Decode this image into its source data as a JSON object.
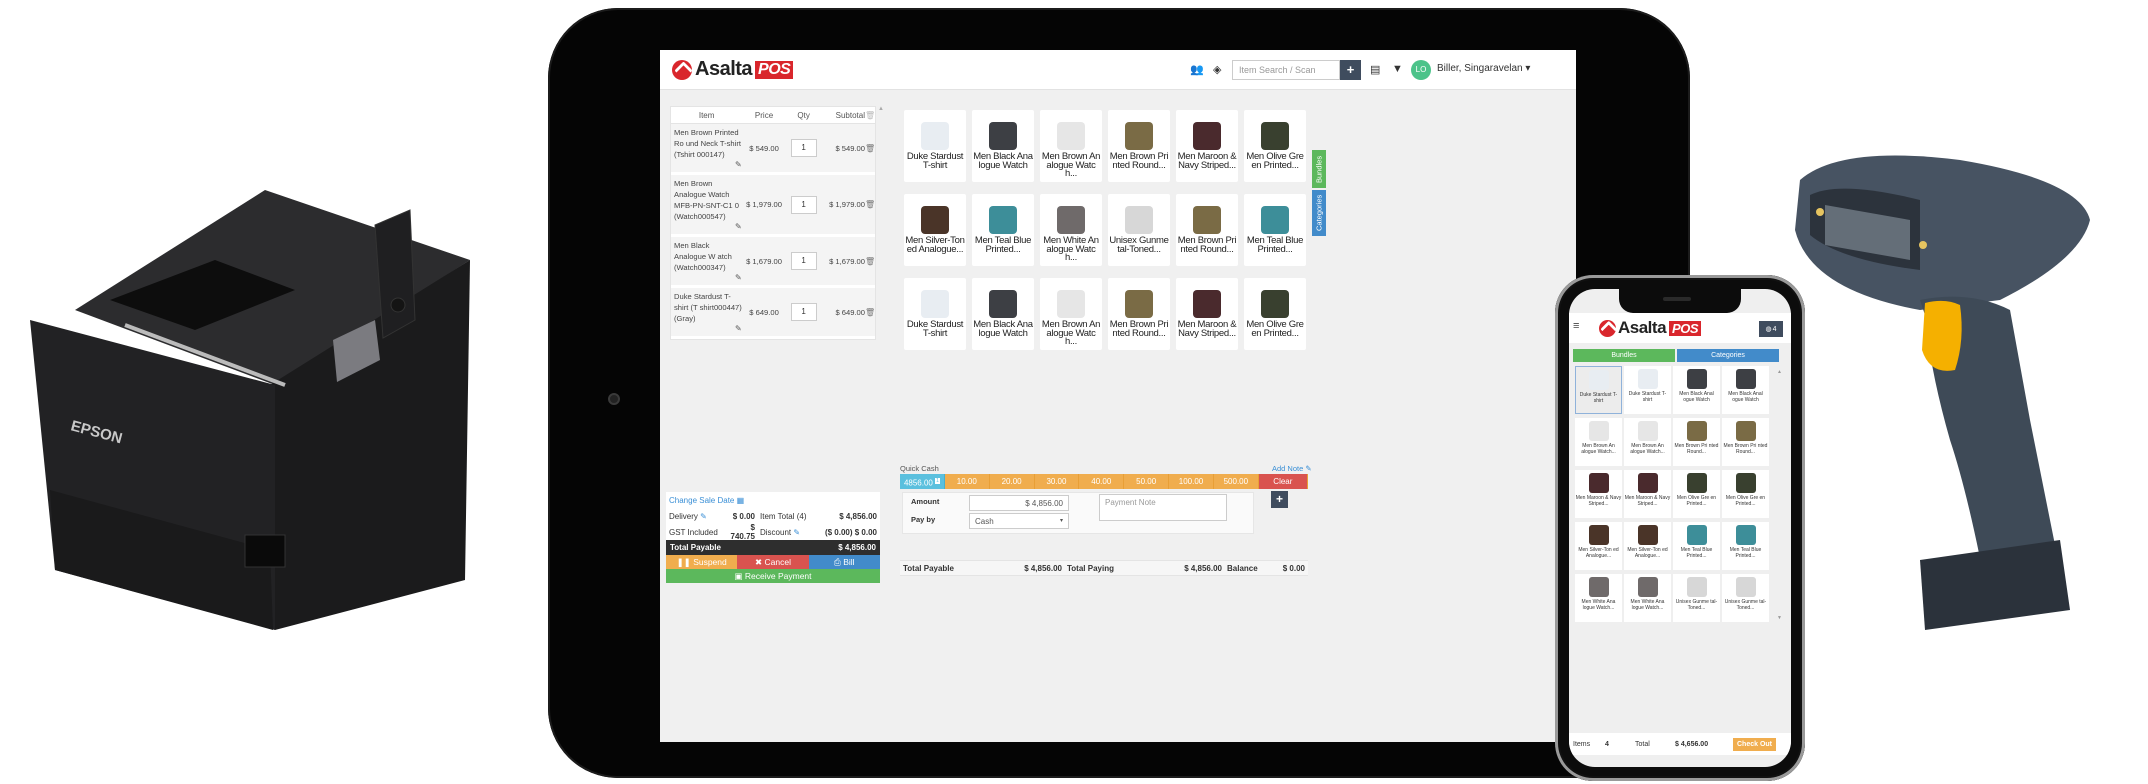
{
  "tablet": {
    "app": {
      "logo_text": "Asalta",
      "logo_badge": "POS"
    },
    "topbar": {
      "customers_icon": "users-icon",
      "inventory_icon": "cube-icon",
      "search_placeholder": "Item Search / Scan",
      "add_button": "+",
      "register_icon": "register-icon",
      "dropdown_icon": "caret-down-icon",
      "avatar_initials": "LO",
      "user_name": "Biller, Singaravelan ▾"
    },
    "cart": {
      "columns": [
        "Item",
        "Price",
        "Qty",
        "Subtotal"
      ],
      "items": [
        {
          "name": "Men Brown Printed Ro und Neck T-shirt (Tshirt 000147)",
          "price": "$ 549.00",
          "qty": "1",
          "subtotal": "$ 549.00"
        },
        {
          "name": "Men Brown Analogue Watch MFB-PN-SNT-C1 0 (Watch000547)",
          "price": "$ 1,979.00",
          "qty": "1",
          "subtotal": "$ 1,979.00"
        },
        {
          "name": "Men Black Analogue W atch (Watch000347)",
          "price": "$ 1,679.00",
          "qty": "1",
          "subtotal": "$ 1,679.00"
        },
        {
          "name": "Duke Stardust T-shirt (T shirt000447) (Gray)",
          "price": "$ 649.00",
          "qty": "1",
          "subtotal": "$ 649.00"
        }
      ]
    },
    "totals": {
      "change_sale_date": "Change Sale Date",
      "delivery_label": "Delivery",
      "delivery_value": "$ 0.00",
      "item_total_label": "Item Total (4)",
      "item_total_value": "$ 4,856.00",
      "gst_label": "GST Included",
      "gst_value": "$ 740.75",
      "discount_label": "Discount",
      "discount_value": "($ 0.00) $ 0.00",
      "total_payable_label": "Total Payable",
      "total_payable_value": "$ 4,856.00",
      "suspend": "Suspend",
      "cancel": "Cancel",
      "bill": "Bill",
      "receive_payment": "Receive Payment"
    },
    "side_tabs": {
      "bundles": "Bundles",
      "categories": "Categories"
    },
    "products": [
      "Duke Stardust T-shirt",
      "Men Black Ana logue Watch",
      "Men Brown An alogue Watc h...",
      "Men Brown Pri nted Round...",
      "Men Maroon & Navy Striped...",
      "Men Olive Gre en Printed...",
      "Men Silver-Ton ed Analogue...",
      "Men Teal Blue Printed...",
      "Men White An alogue Watc h...",
      "Unisex Gunme tal-Toned...",
      "Men Brown Pri nted Round...",
      "Men Teal Blue Printed...",
      "Duke Stardust T-shirt",
      "Men Black Ana logue Watch",
      "Men Brown An alogue Watc h...",
      "Men Brown Pri nted Round...",
      "Men Maroon & Navy Striped...",
      "Men Olive Gre en Printed..."
    ],
    "payment": {
      "quick_cash_label": "Quick Cash",
      "add_note": "Add Note",
      "quick_cash": [
        "4856.00",
        "10.00",
        "20.00",
        "30.00",
        "40.00",
        "50.00",
        "100.00",
        "500.00"
      ],
      "quick_cash_badge": "1",
      "clear": "Clear",
      "amount_label": "Amount",
      "amount_value": "$ 4,856.00",
      "pay_by_label": "Pay by",
      "pay_by_value": "Cash",
      "payment_note_placeholder": "Payment Note",
      "add_payment": "+"
    },
    "summary": {
      "total_payable_label": "Total Payable",
      "total_payable_value": "$ 4,856.00",
      "total_paying_label": "Total Paying",
      "total_paying_value": "$ 4,856.00",
      "balance_label": "Balance",
      "balance_value": "$ 0.00"
    }
  },
  "phone": {
    "logo_text": "Asalta",
    "logo_badge": "POS",
    "cart_count": "4",
    "bundles": "Bundles",
    "categories": "Categories",
    "products": [
      "Duke Stardust T-shirt",
      "Duke Stardust T-shirt",
      "Men Black Anal ogue Watch",
      "Men Black Anal ogue Watch",
      "Men Brown An alogue Watch...",
      "Men Brown An alogue Watch...",
      "Men Brown Pri nted Round...",
      "Men Brown Pri nted Round...",
      "Men Maroon & Navy Striped...",
      "Men Maroon & Navy Striped...",
      "Men Olive Gre en Printed...",
      "Men Olive Gre en Printed...",
      "Men Silver-Ton ed Analogue...",
      "Men Silver-Ton ed Analogue...",
      "Men Teal Blue Printed...",
      "Men Teal Blue Printed...",
      "Men White Ana logue Watch...",
      "Men White Ana logue Watch...",
      "Unisex Gunme tal-Toned...",
      "Unisex Gunme tal-Toned..."
    ],
    "footer": {
      "items_label": "Items",
      "items_value": "4",
      "total_label": "Total",
      "total_value": "$ 4,656.00",
      "checkout": "Check Out"
    }
  },
  "printer": {
    "brand": "EPSON"
  },
  "colors": {
    "brand_red": "#d9262c",
    "warning": "#f0ad4e",
    "danger": "#d9534f",
    "info": "#5bc0de",
    "primary": "#428bca",
    "success": "#5cb85c",
    "dark": "#3f4c5e"
  }
}
